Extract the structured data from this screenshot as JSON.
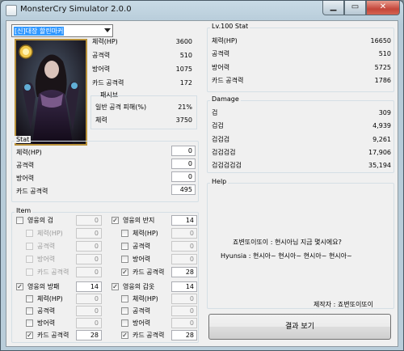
{
  "window": {
    "title": "MonsterCry Simulator 2.0.0",
    "minimize_glyph": "▁",
    "maximize_glyph": "▭",
    "close_glyph": "✕"
  },
  "hero_select": {
    "value": "[신]대장 할린마커"
  },
  "card_stats": [
    {
      "label": "체력(HP)",
      "value": "3600"
    },
    {
      "label": "공격력",
      "value": "510"
    },
    {
      "label": "방어력",
      "value": "1075"
    },
    {
      "label": "카드 공격력",
      "value": "172"
    }
  ],
  "passive": {
    "title": "패시브",
    "rows": [
      {
        "label": "일반 공격 피해(%)",
        "value": "21%"
      },
      {
        "label": "체력",
        "value": "3750"
      }
    ]
  },
  "stat": {
    "title": "Stat",
    "rows": [
      {
        "label": "체력(HP)",
        "value": "0"
      },
      {
        "label": "공격력",
        "value": "0"
      },
      {
        "label": "방어력",
        "value": "0"
      },
      {
        "label": "카드 공격력",
        "value": "495"
      }
    ]
  },
  "item": {
    "title": "Item",
    "groups": [
      {
        "name": "영웅의 검",
        "checked": false,
        "value": "0",
        "subs": [
          {
            "label": "체력(HP)",
            "checked": false,
            "value": "0"
          },
          {
            "label": "공격력",
            "checked": false,
            "value": "0"
          },
          {
            "label": "방어력",
            "checked": false,
            "value": "0"
          },
          {
            "label": "카드 공격력",
            "checked": false,
            "value": "0"
          }
        ]
      },
      {
        "name": "영웅의 반지",
        "checked": true,
        "value": "14",
        "subs": [
          {
            "label": "체력(HP)",
            "checked": false,
            "value": "0"
          },
          {
            "label": "공격력",
            "checked": false,
            "value": "0"
          },
          {
            "label": "방어력",
            "checked": false,
            "value": "0"
          },
          {
            "label": "카드 공격력",
            "checked": true,
            "value": "28"
          }
        ]
      },
      {
        "name": "영웅의 방패",
        "checked": true,
        "value": "14",
        "subs": [
          {
            "label": "체력(HP)",
            "checked": false,
            "value": "0"
          },
          {
            "label": "공격력",
            "checked": false,
            "value": "0"
          },
          {
            "label": "방어력",
            "checked": false,
            "value": "0"
          },
          {
            "label": "카드 공격력",
            "checked": true,
            "value": "28"
          }
        ]
      },
      {
        "name": "영웅의 갑옷",
        "checked": true,
        "value": "14",
        "subs": [
          {
            "label": "체력(HP)",
            "checked": false,
            "value": "0"
          },
          {
            "label": "공격력",
            "checked": false,
            "value": "0"
          },
          {
            "label": "방어력",
            "checked": false,
            "value": "0"
          },
          {
            "label": "카드 공격력",
            "checked": true,
            "value": "28"
          }
        ]
      }
    ]
  },
  "lv100": {
    "title": "Lv.100 Stat",
    "rows": [
      {
        "label": "체력(HP)",
        "value": "16650"
      },
      {
        "label": "공격력",
        "value": "510"
      },
      {
        "label": "방어력",
        "value": "5725"
      },
      {
        "label": "카드 공격력",
        "value": "1786"
      }
    ]
  },
  "damage": {
    "title": "Damage",
    "rows": [
      {
        "label": "검",
        "value": "309"
      },
      {
        "label": "검검",
        "value": "4,939"
      },
      {
        "label": "검검검",
        "value": "9,261"
      },
      {
        "label": "검검검검",
        "value": "17,906"
      },
      {
        "label": "검검검검검",
        "value": "35,194"
      }
    ]
  },
  "help": {
    "title": "Help",
    "line1": "죠변또이또이 : 현시아님 지금 몇시에요?",
    "line2": "Hyunsia : 현시아~ 현시아~ 현시아~ 현시아~",
    "author": "제작자 : 죠변또이또이"
  },
  "result_button": "결과 보기"
}
